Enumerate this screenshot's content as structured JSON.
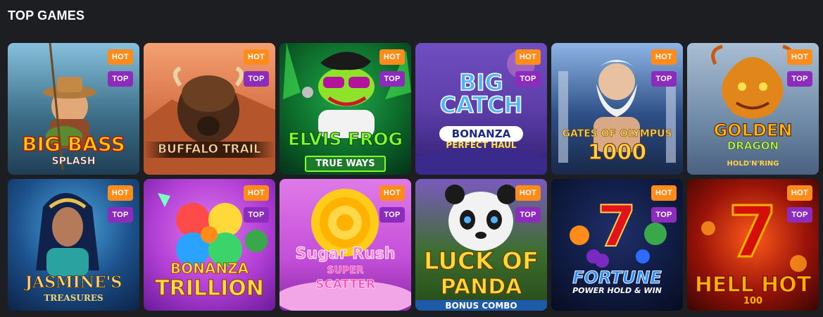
{
  "section": {
    "title": "TOP GAMES"
  },
  "badges": {
    "hot": "HOT",
    "top": "TOP"
  },
  "games": [
    {
      "title": "BIG BASS",
      "subtitle": "SPLASH",
      "bg": "#3d6f88",
      "accent": "#ffcc00"
    },
    {
      "title": "BUFFALO TRAIL",
      "subtitle": "",
      "bg": "#d8744a",
      "accent": "#f4d7a3"
    },
    {
      "title": "ELVIS FROG",
      "subtitle": "TRUE WAYS",
      "bg": "#0d6b2a",
      "accent": "#7fff2a"
    },
    {
      "title": "BIG CATCH",
      "subtitle": "BONANZA",
      "subtitle2": "PERFECT HAUL",
      "bg": "#5d3ea8",
      "accent": "#4fb3ff"
    },
    {
      "title": "GATES OF OLYMPUS",
      "subtitle": "1000",
      "bg": "#2d4f86",
      "accent": "#ffd24a"
    },
    {
      "title": "GOLDEN",
      "subtitle": "DRAGON",
      "subtitle2": "HOLD'N'RING",
      "bg": "#6f8aa6",
      "accent": "#ffb31a"
    },
    {
      "title": "JASMINE'S",
      "subtitle": "TREASURES",
      "bg": "#1c4f8a",
      "accent": "#f6d27a"
    },
    {
      "title": "BONANZA",
      "subtitle": "TRILLION",
      "bg": "#b23fd6",
      "accent": "#ffe14a"
    },
    {
      "title": "Sugar Rush",
      "subtitle": "SUPER",
      "subtitle2": "SCATTER",
      "bg": "#c44fd9",
      "accent": "#ff7ad3"
    },
    {
      "title": "LUCK OF",
      "subtitle": "PANDA",
      "subtitle2": "BONUS COMBO",
      "bg": "#3d6e2d",
      "accent": "#ffd83a"
    },
    {
      "title": "FORTUNE",
      "subtitle": "POWER HOLD & WIN",
      "bg": "#0f1a3f",
      "accent": "#2e8cff"
    },
    {
      "title": "HELL HOT",
      "subtitle": "100",
      "bg": "#9a1308",
      "accent": "#ffb100"
    }
  ]
}
